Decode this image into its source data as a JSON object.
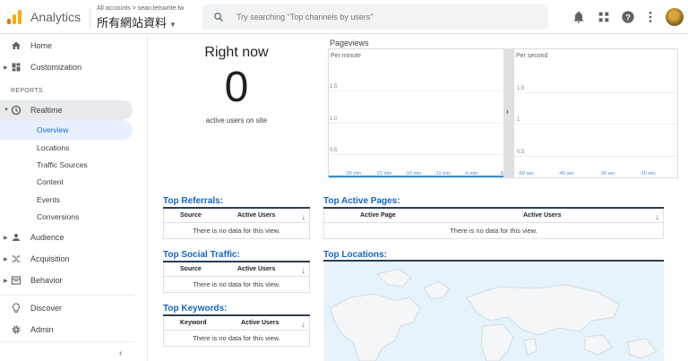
{
  "header": {
    "app_name": "Analytics",
    "breadcrumb": "All accounts > sean.letswrite.tw",
    "account_name": "所有網站資料",
    "search_placeholder": "Try searching \"Top channels by users\"",
    "icons": [
      "bell-icon",
      "apps-icon",
      "help-icon",
      "more-vert-icon",
      "avatar"
    ]
  },
  "sidebar": {
    "items": [
      {
        "label": "Home",
        "icon": "home-icon"
      },
      {
        "label": "Customization",
        "icon": "dashboard-icon"
      }
    ],
    "section_label": "REPORTS",
    "realtime": {
      "label": "Realtime",
      "children": [
        "Overview",
        "Locations",
        "Traffic Sources",
        "Content",
        "Events",
        "Conversions"
      ],
      "selected": "Overview"
    },
    "reports": [
      {
        "label": "Audience",
        "icon": "person-icon"
      },
      {
        "label": "Acquisition",
        "icon": "acquisition-icon"
      },
      {
        "label": "Behavior",
        "icon": "behavior-icon"
      }
    ],
    "footer": [
      {
        "label": "Discover",
        "icon": "lightbulb-icon"
      },
      {
        "label": "Admin",
        "icon": "gear-icon"
      }
    ]
  },
  "right_now": {
    "title": "Right now",
    "value": "0",
    "subtitle": "active users on site"
  },
  "pageviews": {
    "title": "Pageviews",
    "per_minute": {
      "label": "Per minute",
      "y_ticks": [
        "1.5",
        "1.0",
        "0.5"
      ],
      "x_ticks": [
        "-26 min",
        "-21 min",
        "-16 min",
        "-11 min",
        "-6 min",
        "-1"
      ]
    },
    "per_second": {
      "label": "Per second",
      "y_ticks": [
        "1.5",
        "1",
        "0.5"
      ],
      "x_ticks": [
        "-60 sec",
        "-45 sec",
        "-30 sec",
        "-15 sec"
      ]
    },
    "toggle_glyph": "›"
  },
  "tables": {
    "sort_glyph": "↓",
    "empty_text": "There is no data for this view.",
    "top_referrals": {
      "title": "Top Referrals:",
      "col1": "Source",
      "col2": "Active Users"
    },
    "top_social": {
      "title": "Top Social Traffic:",
      "col1": "Source",
      "col2": "Active Users"
    },
    "top_keywords": {
      "title": "Top Keywords:",
      "col1": "Keyword",
      "col2": "Active Users"
    },
    "top_pages": {
      "title": "Top Active Pages:",
      "col1": "Active Page",
      "col2": "Active Users"
    },
    "top_locations": {
      "title": "Top Locations:"
    }
  },
  "collapse_glyph": "‹",
  "colors": {
    "accent": "#1a73e8",
    "table_title": "#1565c0",
    "chart_baseline": "#3c8fc6"
  }
}
